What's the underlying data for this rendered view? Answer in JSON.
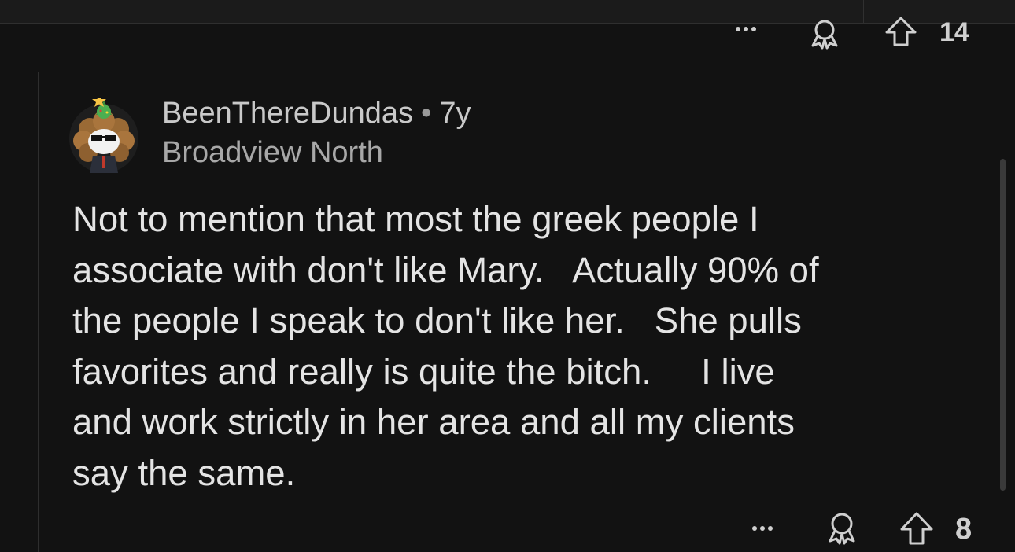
{
  "previous_comment": {
    "upvote_count": "14",
    "more_icon": "more-dots-icon",
    "award_icon": "award-icon",
    "upvote_icon": "upvote-arrow-icon"
  },
  "comment": {
    "username": "BeenThereDundas",
    "separator": "•",
    "age": "7y",
    "flair": "Broadview North",
    "avatar_icon": "snoo-avatar-icon",
    "body": "Not to mention that most the greek people I\nassociate with don't like Mary.   Actually 90% of\nthe people I speak to don't like her.   She pulls\nfavorites and really is quite the bitch.     I live\nand work strictly in her area and all my clients\nsay the same.",
    "upvote_count": "8",
    "more_icon": "more-dots-icon",
    "award_icon": "award-icon",
    "upvote_icon": "upvote-arrow-icon"
  },
  "colors": {
    "background": "#121212",
    "text": "#e4e4e4",
    "muted": "#a8a8a8",
    "thread_line": "#2e2e2e"
  }
}
